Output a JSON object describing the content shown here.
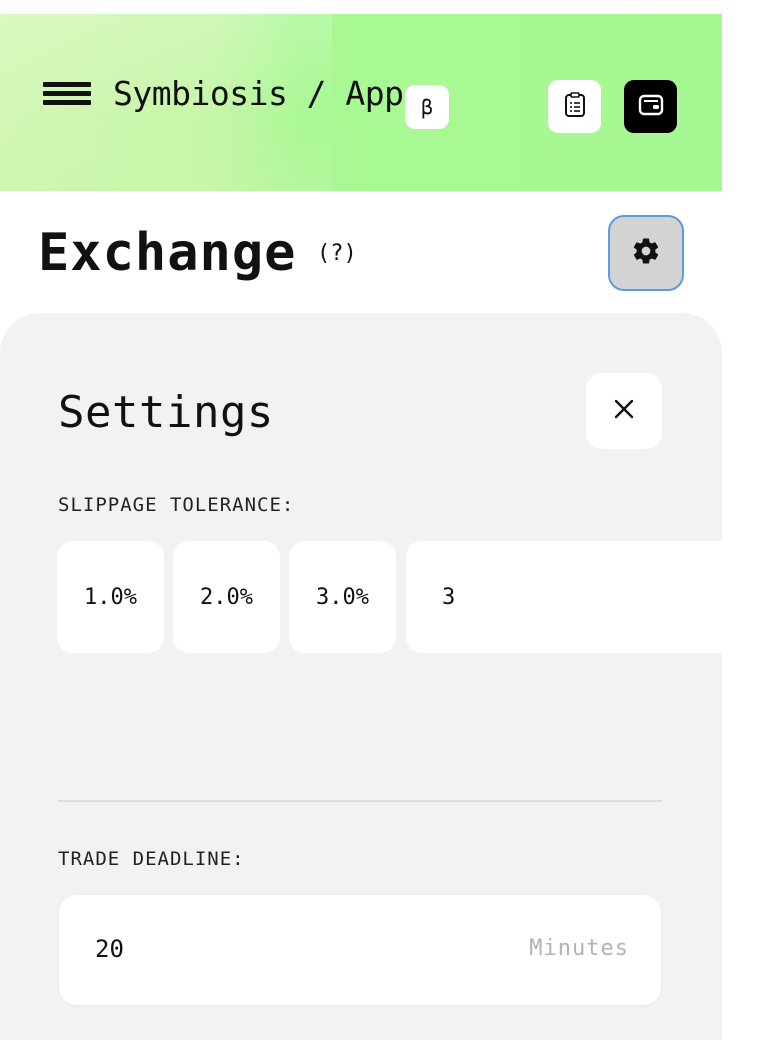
{
  "header": {
    "brand": "Symbiosis / App",
    "beta_badge": "β",
    "icons": {
      "menu": "hamburger-menu-icon",
      "history": "clipboard-icon",
      "wallet": "wallet-icon"
    },
    "colors": {
      "background": "#a6f891",
      "wallet_button": "#000000"
    }
  },
  "exchange": {
    "title": "Exchange",
    "help": "(?)",
    "settings_icon": "gear-icon"
  },
  "settings": {
    "title": "Settings",
    "close_icon": "close-icon",
    "slippage": {
      "label": "SLIPPAGE TOLERANCE:",
      "options": [
        "1.0%",
        "2.0%",
        "3.0%"
      ],
      "custom_value": "3"
    },
    "deadline": {
      "label": "TRADE DEADLINE:",
      "value": "20",
      "unit": "Minutes"
    }
  }
}
